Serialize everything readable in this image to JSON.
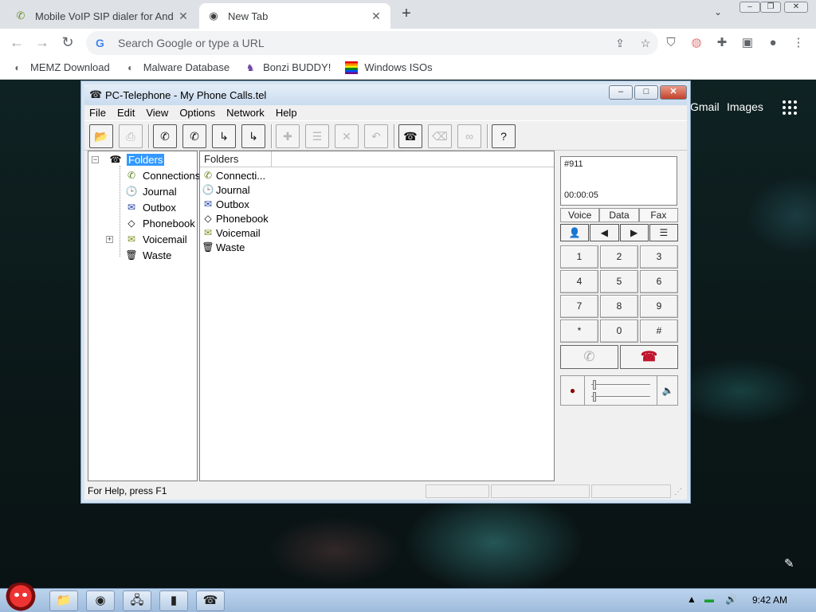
{
  "browser": {
    "tabs": [
      {
        "title": "Mobile VoIP SIP dialer for And",
        "favicon": "phone-handset-icon",
        "close": "✕"
      },
      {
        "title": "New Tab",
        "favicon": "chrome-icon",
        "close": "✕"
      }
    ],
    "new_tab": "+",
    "tab_search": "⌄",
    "window_controls": {
      "minimize": "–",
      "restore": "❐",
      "close": "✕"
    },
    "nav": {
      "back": "←",
      "forward": "→",
      "reload": "↻"
    },
    "omnibox": {
      "placeholder": "Search Google or type a URL",
      "google_icon": "G"
    },
    "bookmarks": [
      {
        "label": "MEMZ Download",
        "icon": "globe-icon"
      },
      {
        "label": "Malware Database",
        "icon": "globe-icon"
      },
      {
        "label": "Bonzi BUDDY!",
        "icon": "bonzi-icon"
      },
      {
        "label": "Windows ISOs",
        "icon": "rainbow-flag-icon"
      }
    ]
  },
  "newtab_page": {
    "links": [
      "Gmail",
      "Images"
    ],
    "gmail_visible": "Gmail",
    "images": "Images"
  },
  "app": {
    "title": "PC-Telephone - My Phone Calls.tel",
    "menu": [
      "File",
      "Edit",
      "View",
      "Options",
      "Network",
      "Help"
    ],
    "tree": {
      "root": "Folders",
      "children": [
        "Connections",
        "Journal",
        "Outbox",
        "Phonebook",
        "Voicemail",
        "Waste"
      ]
    },
    "list": {
      "header": "Folders",
      "items": [
        "Connecti...",
        "Journal",
        "Outbox",
        "Phonebook",
        "Voicemail",
        "Waste"
      ]
    },
    "phone": {
      "display_number": "#911",
      "display_time": "00:00:05",
      "modes": [
        "Voice",
        "Data",
        "Fax"
      ],
      "keys": [
        "1",
        "2",
        "3",
        "4",
        "5",
        "6",
        "7",
        "8",
        "9",
        "*",
        "0",
        "#"
      ]
    },
    "status": "For Help, press F1"
  },
  "taskbar": {
    "clock": "9:42 AM"
  }
}
